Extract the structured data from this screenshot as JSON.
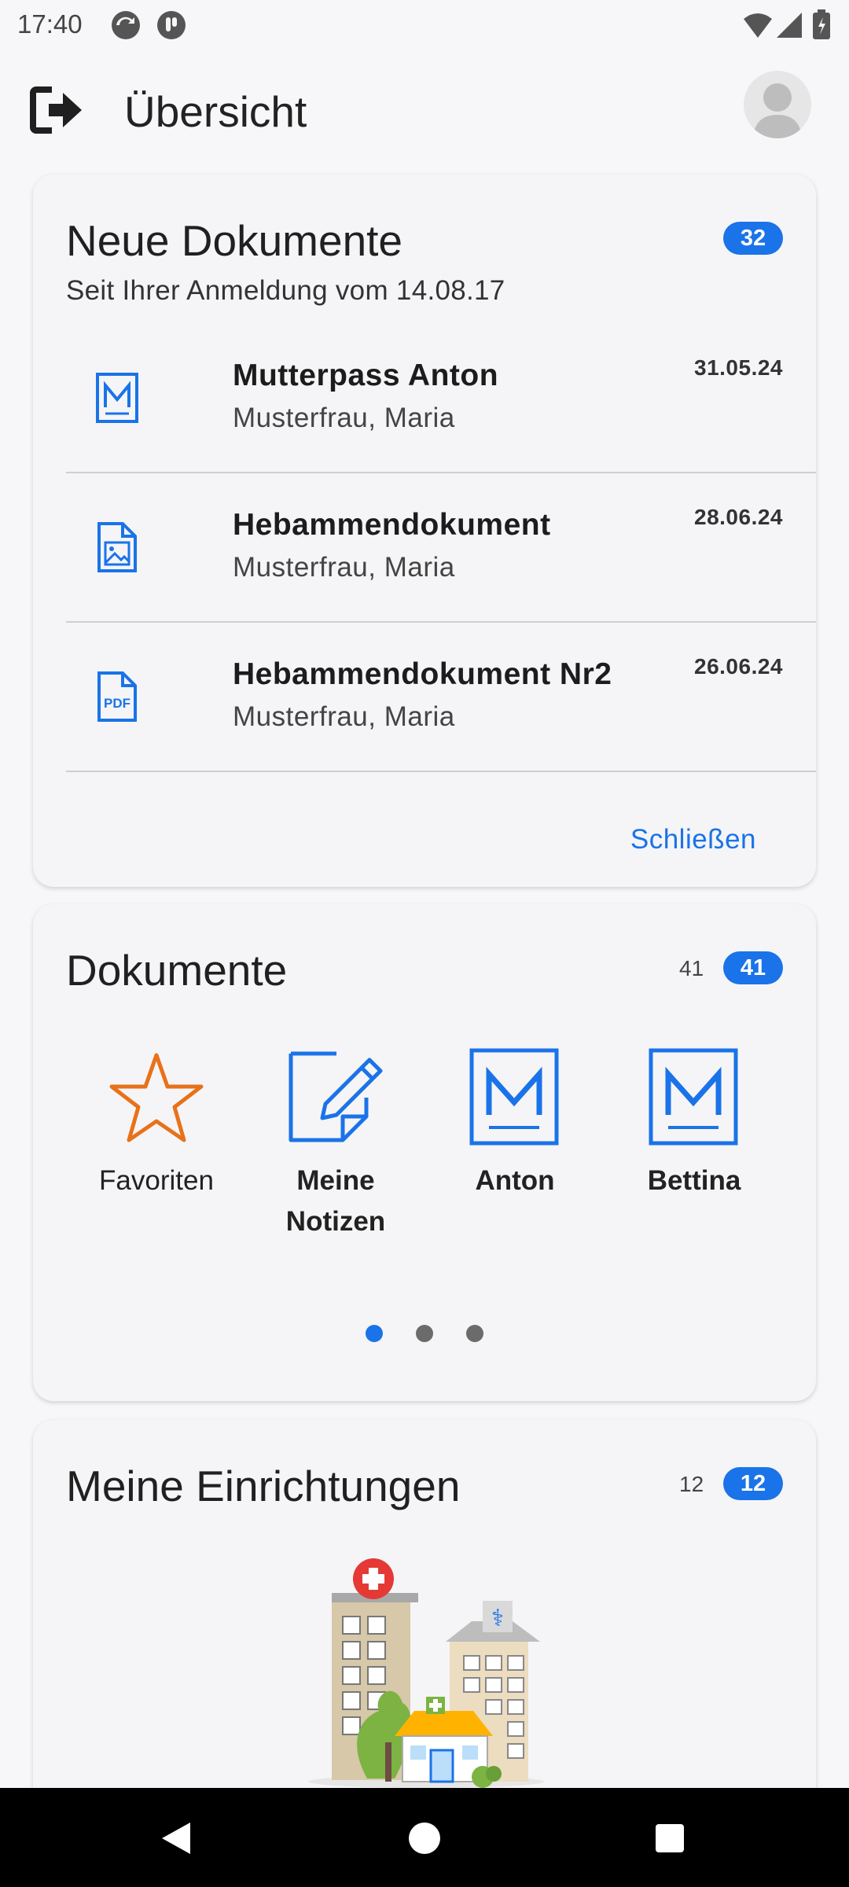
{
  "status_bar": {
    "time": "17:40"
  },
  "app_bar": {
    "title": "Übersicht"
  },
  "new_documents": {
    "title": "Neue Dokumente",
    "subtitle": "Seit Ihrer Anmeldung vom 14.08.17",
    "badge": "32",
    "items": [
      {
        "title": "Mutterpass Anton",
        "author": "Musterfrau, Maria",
        "date": "31.05.24",
        "icon": "mutterpass-icon"
      },
      {
        "title": "Hebammendokument",
        "author": "Musterfrau, Maria",
        "date": "28.06.24",
        "icon": "image-document-icon"
      },
      {
        "title": "Hebammendokument Nr2",
        "author": "Musterfrau, Maria",
        "date": "26.06.24",
        "icon": "pdf-document-icon"
      }
    ],
    "close_label": "Schließen"
  },
  "documents": {
    "title": "Dokumente",
    "count": "41",
    "badge": "41",
    "tiles": [
      {
        "label": "Favoriten",
        "icon": "star-icon"
      },
      {
        "label": "Meine Notizen",
        "icon": "note-edit-icon"
      },
      {
        "label": "Anton",
        "icon": "mutterpass-icon"
      },
      {
        "label": "Bettina",
        "icon": "mutterpass-icon"
      }
    ],
    "page_count": 3,
    "active_page": 1
  },
  "facilities": {
    "title": "Meine Einrichtungen",
    "count": "12",
    "badge": "12"
  },
  "colors": {
    "accent": "#1a73e8",
    "star": "#e8711a",
    "background": "#f7f7f9"
  },
  "nav_bar": {
    "back": "back-icon",
    "home": "home-icon",
    "recents": "recents-icon"
  }
}
